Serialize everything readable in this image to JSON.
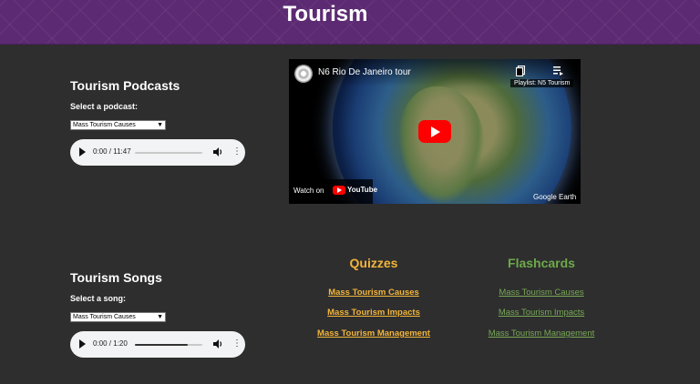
{
  "header": {
    "title": "Tourism"
  },
  "podcasts": {
    "title": "Tourism Podcasts",
    "select_label": "Select a podcast:",
    "selected": "Mass Tourism Causes",
    "player": {
      "time": "0:00 / 11:47",
      "progress": 0
    }
  },
  "songs": {
    "title": "Tourism Songs",
    "select_label": "Select a song:",
    "selected": "Mass Tourism Causes",
    "player": {
      "time": "0:00 / 1:20",
      "progress": 0.78
    }
  },
  "video": {
    "title": "N6 Rio De Janeiro tour",
    "playlist_label": "Playlist: N5 Tourism",
    "watch_on": "Watch on",
    "youtube": "YouTube",
    "watermark": "Google Earth"
  },
  "quizzes": {
    "heading": "Quizzes",
    "links": [
      "Mass Tourism Causes",
      "Mass Tourism Impacts",
      "Mass Tourism Management"
    ]
  },
  "flashcards": {
    "heading": "Flashcards",
    "links": [
      "Mass Tourism Causes",
      "Mass Tourism Impacts",
      "Mass Tourism Management"
    ]
  },
  "colors": {
    "header_purple": "#5c2a72",
    "background": "#2e2e2e",
    "quiz_accent": "#f2b53a",
    "flashcard_accent": "#6ea84a"
  },
  "icons": [
    "play-icon",
    "volume-icon",
    "more-options-icon",
    "copy-link-icon",
    "playlist-icon",
    "youtube-play-icon",
    "youtube-logo-icon",
    "chevron-down-icon"
  ]
}
